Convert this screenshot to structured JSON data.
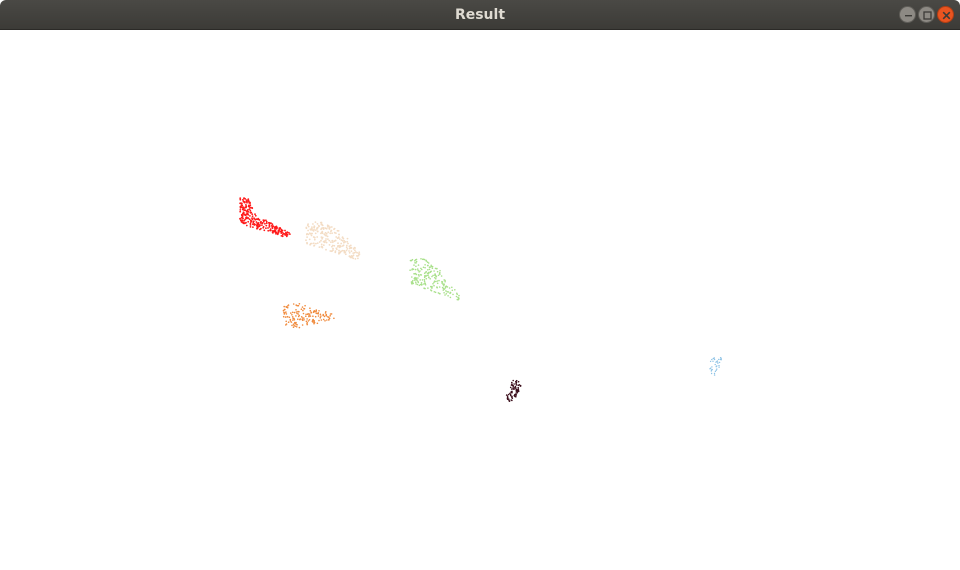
{
  "window": {
    "title": "Result",
    "controls": {
      "minimize_icon": "minimize-icon",
      "maximize_icon": "maximize-icon",
      "close_icon": "close-icon"
    },
    "accent_close": "#e95420",
    "titlebar_color": "#3c3b37"
  },
  "scene": {
    "background": "#ffffff",
    "clusters": [
      {
        "name": "red",
        "color": "#ff1a1a"
      },
      {
        "name": "beige",
        "color": "#f3dcc4"
      },
      {
        "name": "light-green",
        "color": "#a8e08a"
      },
      {
        "name": "orange",
        "color": "#f08a3c"
      },
      {
        "name": "dark-maroon",
        "color": "#3a0d1a"
      },
      {
        "name": "light-blue",
        "color": "#8ec3e6"
      }
    ]
  }
}
